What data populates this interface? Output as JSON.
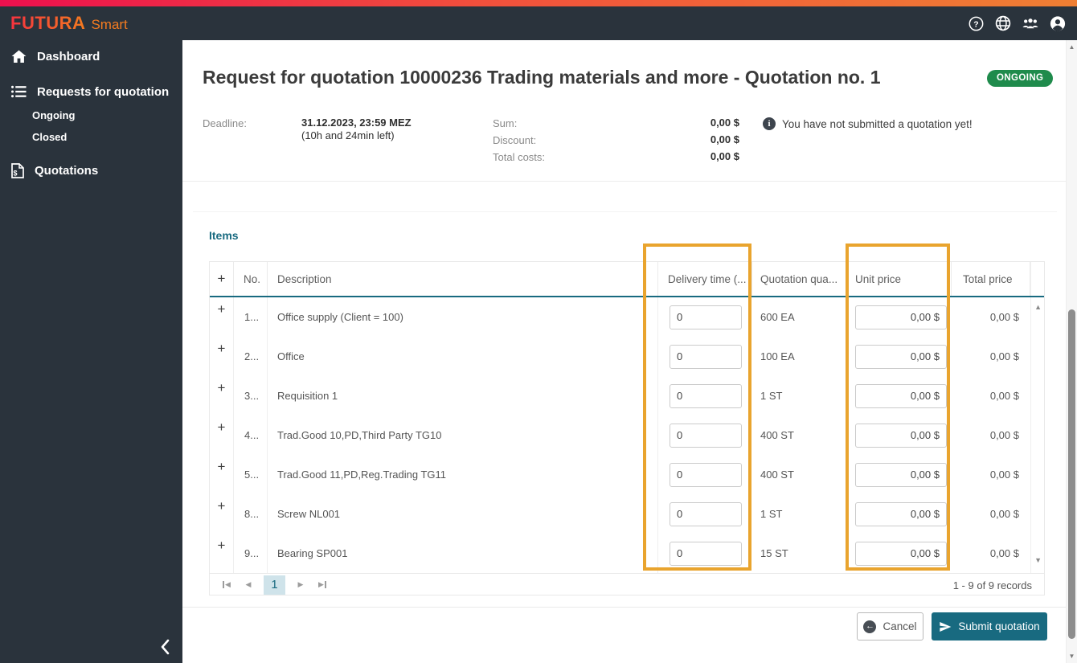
{
  "brand": {
    "name": "FUTURA",
    "suffix": "Smart"
  },
  "sidebar": {
    "dashboard": "Dashboard",
    "requests": "Requests for quotation",
    "ongoing": "Ongoing",
    "closed": "Closed",
    "quotations": "Quotations"
  },
  "page": {
    "title": "Request for quotation 10000236 Trading materials and more - Quotation no. 1",
    "status_badge": "ONGOING",
    "deadline_label": "Deadline:",
    "deadline_value": "31.12.2023, 23:59 MEZ",
    "deadline_remaining": "(10h and 24min left)",
    "sum_label": "Sum:",
    "sum_value": "0,00 $",
    "discount_label": "Discount:",
    "discount_value": "0,00 $",
    "total_label": "Total costs:",
    "total_value": "0,00 $",
    "notice": "You have not submitted a quotation yet!"
  },
  "items": {
    "section_title": "Items",
    "columns": {
      "expander": "+",
      "no": "No.",
      "description": "Description",
      "delivery": "Delivery time (...",
      "quantity": "Quotation qua...",
      "unit_price": "Unit price",
      "total_price": "Total price"
    },
    "rows": [
      {
        "no": "1...",
        "description": "Office supply (Client = 100)",
        "delivery": "0",
        "quantity": "600 EA",
        "unit_price": "0,00 $",
        "total_price": "0,00 $"
      },
      {
        "no": "2...",
        "description": "Office",
        "delivery": "0",
        "quantity": "100 EA",
        "unit_price": "0,00 $",
        "total_price": "0,00 $"
      },
      {
        "no": "3...",
        "description": "Requisition 1",
        "delivery": "0",
        "quantity": "1 ST",
        "unit_price": "0,00 $",
        "total_price": "0,00 $"
      },
      {
        "no": "4...",
        "description": "Trad.Good 10,PD,Third Party TG10",
        "delivery": "0",
        "quantity": "400 ST",
        "unit_price": "0,00 $",
        "total_price": "0,00 $"
      },
      {
        "no": "5...",
        "description": "Trad.Good 11,PD,Reg.Trading TG11",
        "delivery": "0",
        "quantity": "400 ST",
        "unit_price": "0,00 $",
        "total_price": "0,00 $"
      },
      {
        "no": "8...",
        "description": "Screw NL001",
        "delivery": "0",
        "quantity": "1 ST",
        "unit_price": "0,00 $",
        "total_price": "0,00 $"
      },
      {
        "no": "9...",
        "description": "Bearing SP001",
        "delivery": "0",
        "quantity": "15 ST",
        "unit_price": "0,00 $",
        "total_price": "0,00 $"
      }
    ],
    "pagination": {
      "page": "1",
      "records": "1 - 9 of 9 records"
    }
  },
  "footer": {
    "cancel": "Cancel",
    "submit": "Submit quotation"
  },
  "glyphs": {
    "prev": "◀",
    "next": "▶",
    "up": "▲",
    "down": "▼",
    "info": "i",
    "back_arrow": "←"
  },
  "colors": {
    "accent_teal": "#186a80",
    "badge_green": "#1f8b4c",
    "highlight_orange": "#e9a42e",
    "sidebar_dark": "#2a333c",
    "gradient_start": "#ed104e",
    "gradient_end": "#ef7f33"
  }
}
